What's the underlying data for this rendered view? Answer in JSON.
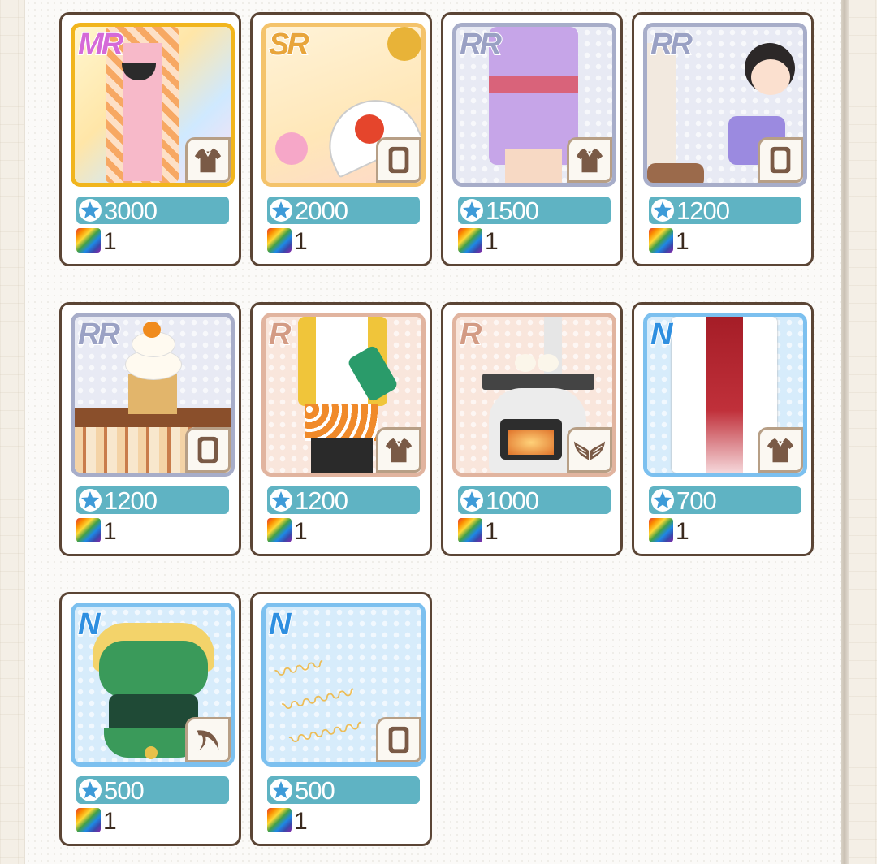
{
  "items": [
    {
      "rarity": "MR",
      "type": "clothing",
      "price": "3000",
      "qty": "1",
      "theme": "mr"
    },
    {
      "rarity": "SR",
      "type": "card",
      "price": "2000",
      "qty": "1",
      "theme": "sr"
    },
    {
      "rarity": "RR",
      "type": "clothing",
      "price": "1500",
      "qty": "1",
      "theme": "rr"
    },
    {
      "rarity": "RR",
      "type": "card",
      "price": "1200",
      "qty": "1",
      "theme": "rr"
    },
    {
      "rarity": "RR",
      "type": "card",
      "price": "1200",
      "qty": "1",
      "theme": "rr"
    },
    {
      "rarity": "R",
      "type": "clothing",
      "price": "1200",
      "qty": "1",
      "theme": "r"
    },
    {
      "rarity": "R",
      "type": "wings",
      "price": "1000",
      "qty": "1",
      "theme": "r"
    },
    {
      "rarity": "N",
      "type": "clothing",
      "price": "700",
      "qty": "1",
      "theme": "n"
    },
    {
      "rarity": "N",
      "type": "horn",
      "price": "500",
      "qty": "1",
      "theme": "n"
    },
    {
      "rarity": "N",
      "type": "card",
      "price": "500",
      "qty": "1",
      "theme": "n"
    }
  ],
  "icons": {
    "price": "star-icon",
    "quantity": "rainbow-gem-icon",
    "clothing": "shirt-icon",
    "card": "card-frame-icon",
    "wings": "wings-icon",
    "horn": "horn-icon"
  },
  "colors": {
    "price_bar": "#5fb3c3",
    "card_border": "#5b4535",
    "mr_frame": "#f1b51d",
    "rr_frame": "#a7adc9",
    "r_frame": "#e1b49f",
    "n_frame": "#7cc0ef"
  }
}
